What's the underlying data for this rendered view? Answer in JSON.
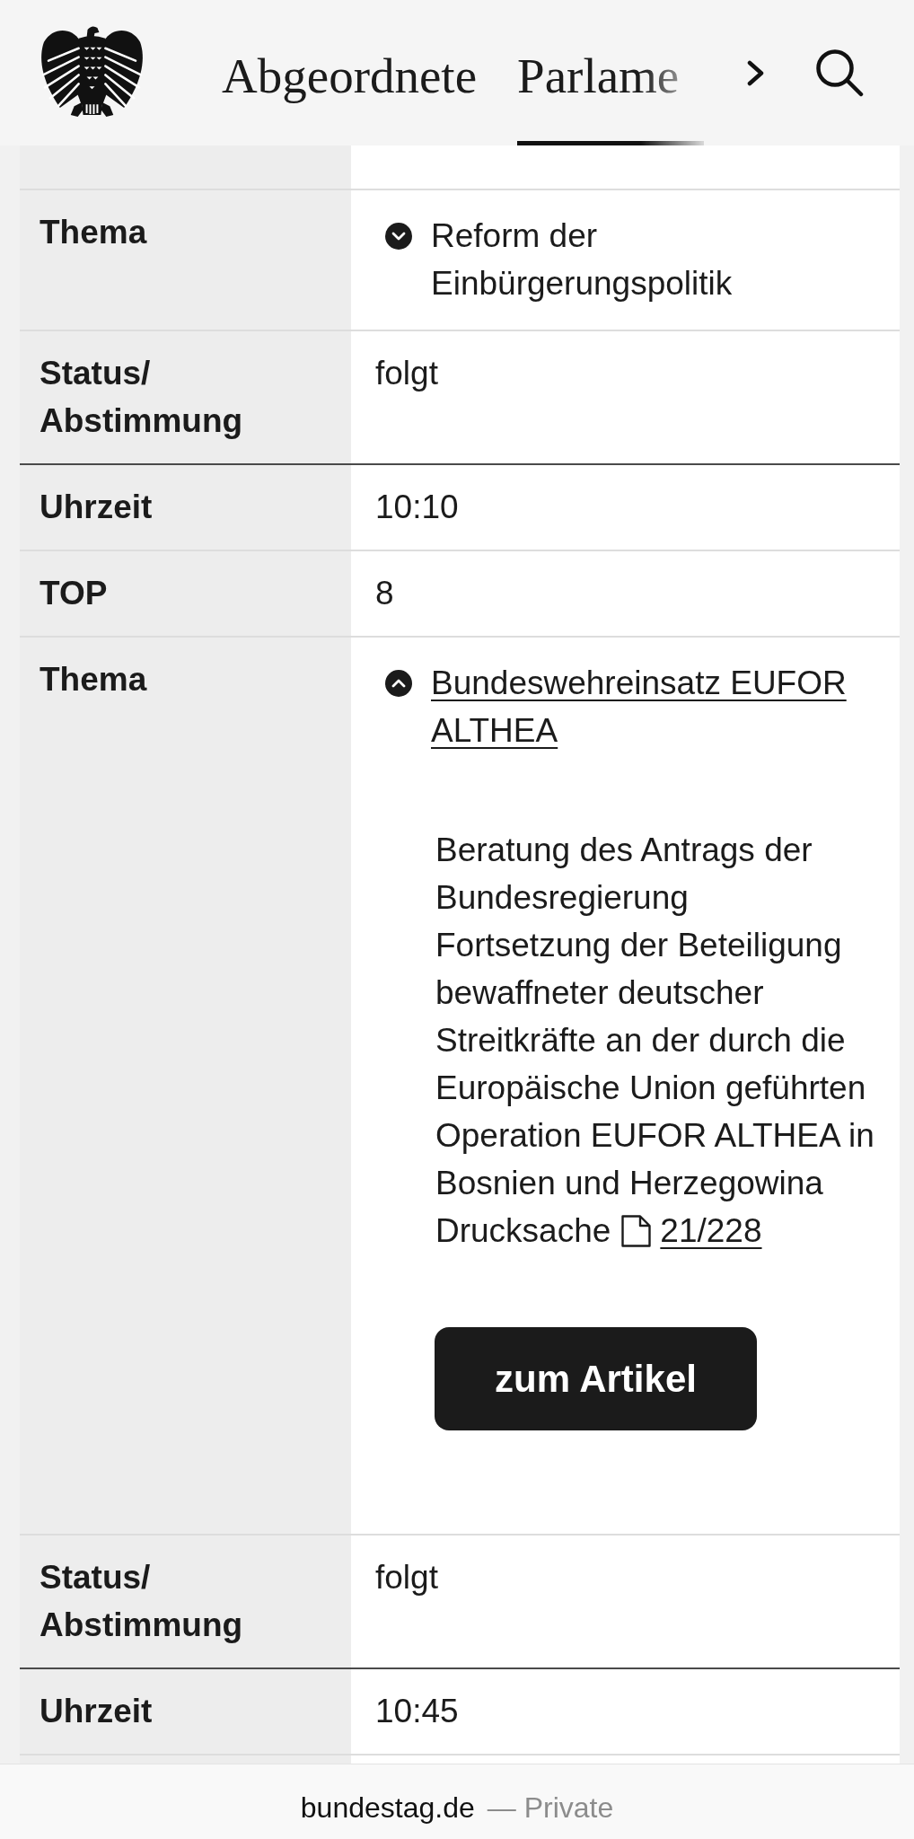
{
  "header": {
    "nav": [
      {
        "label": "Abgeordnete",
        "selected": false
      },
      {
        "label": "Parlame",
        "selected": true
      }
    ]
  },
  "agenda": [
    {
      "rows": [
        {
          "kind": "topic",
          "label": "Thema",
          "title": "Reform der Einbürgerungspolitik",
          "expanded": false
        },
        {
          "kind": "text",
          "label": "Status/Abstimmung",
          "value": "folgt"
        }
      ]
    },
    {
      "rows": [
        {
          "kind": "text",
          "label": "Uhrzeit",
          "value": "10:10"
        },
        {
          "kind": "text",
          "label": "TOP",
          "value": "8"
        },
        {
          "kind": "topic",
          "label": "Thema",
          "title": "Bundeswehreinsatz EUFOR ALTHEA",
          "expanded": true,
          "details": [
            "Beratung des Antrags der Bundesregierung",
            "Fortsetzung der Beteiligung bewaffneter deutscher Streitkräfte an der durch die Europäische Union geführten Operation EUFOR ALTHEA in Bosnien und Herzegowina"
          ],
          "document": {
            "label": "Drucksache",
            "number": "21/228"
          },
          "button": "zum Artikel"
        },
        {
          "kind": "text",
          "label": "Status/Abstimmung",
          "value": "folgt"
        }
      ]
    },
    {
      "rows": [
        {
          "kind": "text",
          "label": "Uhrzeit",
          "value": "10:45"
        }
      ]
    }
  ],
  "browser_bar": {
    "url": "bundestag.de",
    "mode": "— Private"
  }
}
